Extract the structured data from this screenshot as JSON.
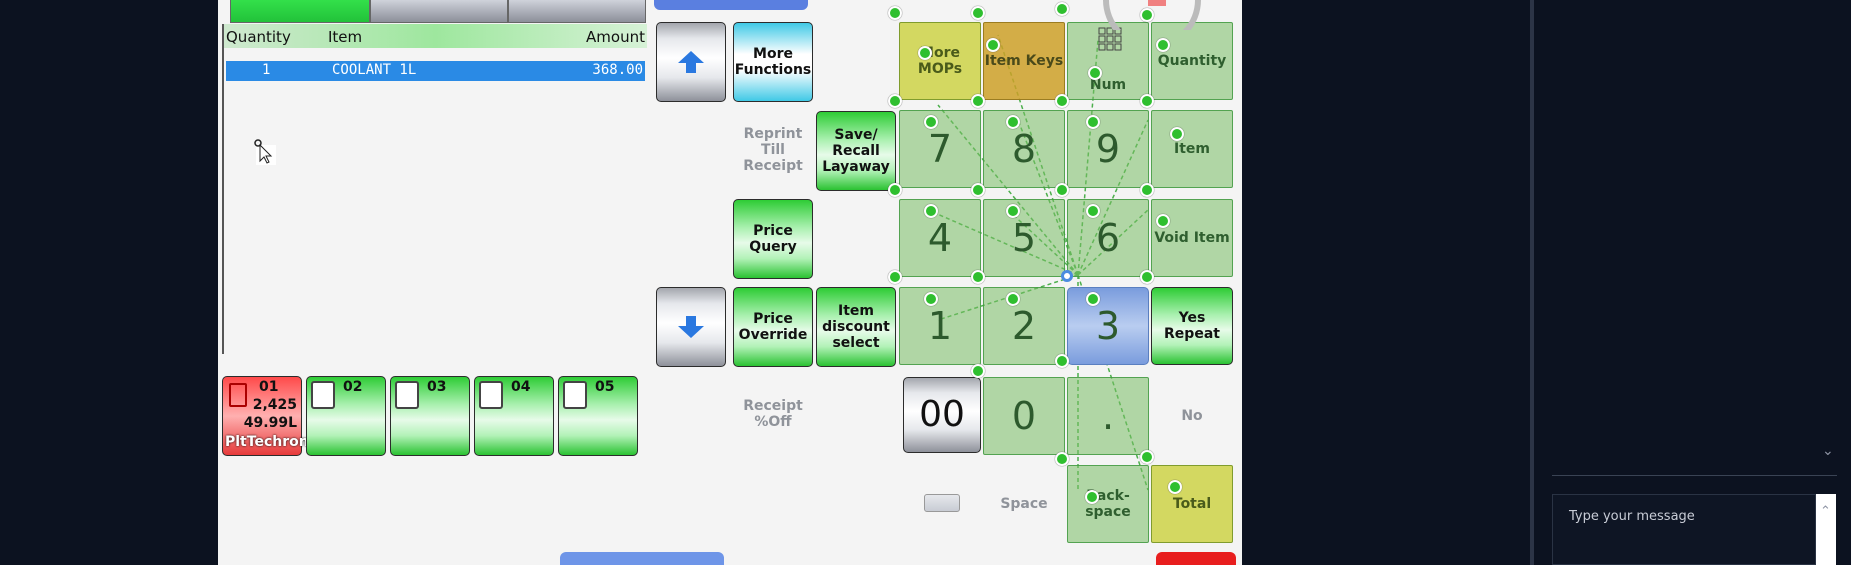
{
  "receipt": {
    "header": {
      "quantity": "Quantity",
      "item": "Item",
      "amount": "Amount"
    },
    "rows": [
      {
        "quantity": "1",
        "item": "COOLANT 1L",
        "amount": "368.00"
      }
    ]
  },
  "buttons": {
    "more_functions": "More Functions",
    "reprint_till_receipt": "Reprint Till Receipt",
    "save_recall_layaway": "Save/ Recall Layaway",
    "price_query": "Price Query",
    "price_override": "Price Override",
    "item_discount_select": "Item discount select",
    "receipt_pct_off": "Receipt %Off",
    "more_mops": "More MOPs",
    "item_keys": "Item Keys",
    "num": "Num",
    "quantity": "Quantity",
    "item": "Item",
    "void_item": "Void Item",
    "yes_repeat": "Yes Repeat",
    "no": "No",
    "space": "Space",
    "backspace": "Back-space",
    "total": "Total",
    "double_zero": "00",
    "zero": "0",
    "dot": ".",
    "d1": "1",
    "d2": "2",
    "d3": "3",
    "d4": "4",
    "d5": "5",
    "d6": "6",
    "d7": "7",
    "d8": "8",
    "d9": "9"
  },
  "pumps": [
    {
      "num": "01",
      "amount": "2,425",
      "volume": "49.99L",
      "label": "PltTechron"
    },
    {
      "num": "02"
    },
    {
      "num": "03"
    },
    {
      "num": "04"
    },
    {
      "num": "05"
    }
  ],
  "chat": {
    "placeholder": "Type your message"
  },
  "colors": {
    "green": "#2ecc35",
    "blue_row": "#2a8ae5",
    "red_pump": "#ff4a4a"
  }
}
